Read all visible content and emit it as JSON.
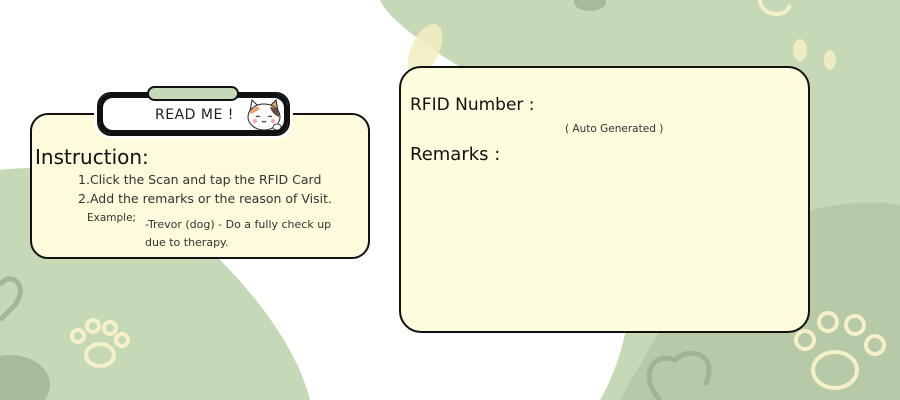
{
  "readme": {
    "tab_label": "READ ME !",
    "instruction_title": "Instruction:",
    "steps": [
      "Click the Scan and tap the RFID Card",
      "Add the remarks or the reason of Visit."
    ],
    "example_label": "Example;",
    "example_line1": "-Trevor (dog) - Do a fully check up",
    "example_line2": "due to therapy."
  },
  "form": {
    "rfid_label": "RFID Number :",
    "rfid_hint": "( Auto Generated  )",
    "remarks_label": "Remarks :"
  },
  "colors": {
    "sage": "#c6d9b6",
    "sage_dark": "#9aae8c",
    "card_bg": "#fdfddd",
    "paw_cream": "#f5f0c8",
    "outline": "#111111"
  },
  "icons": [
    "paw-print-icon",
    "heart-outline-icon",
    "cat-mascot-icon"
  ]
}
